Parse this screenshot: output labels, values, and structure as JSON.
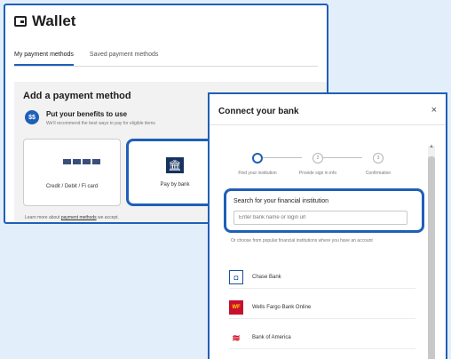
{
  "wallet": {
    "title": "Wallet",
    "tabs": [
      {
        "label": "My payment methods",
        "active": true
      },
      {
        "label": "Saved payment methods",
        "active": false
      }
    ],
    "add_title": "Add a payment method",
    "benefit_title": "Put your benefits to use",
    "benefit_sub": "We'll recommend the best ways to pay for eligible items",
    "cards": [
      {
        "label": "Credit / Debit / Fi card"
      },
      {
        "label": "Pay by bank"
      }
    ],
    "learn_prefix": "Learn more about",
    "learn_link": "payment methods",
    "learn_suffix": "we accept."
  },
  "modal": {
    "title": "Connect your bank",
    "close": "×",
    "steps": [
      {
        "label": "Find your institution"
      },
      {
        "label": "Provide sign in info"
      },
      {
        "label": "Confirmation"
      }
    ],
    "search_label": "Search for your financial institution",
    "search_placeholder": "Enter bank name or login url",
    "popular_note": "Or choose from popular financial institutions where you have an account",
    "banks": [
      {
        "name": "Chase Bank",
        "logo_text": "◘",
        "logo_color": "#1a4fa0"
      },
      {
        "name": "Wells Fargo Bank Online",
        "logo_text": "WF",
        "logo_color": "#c8102e"
      },
      {
        "name": "Bank of America",
        "logo_text": "≋",
        "logo_color": "#d4001a"
      }
    ]
  },
  "colors": {
    "accent": "#1f5fb8",
    "background": "#e3eefb"
  }
}
